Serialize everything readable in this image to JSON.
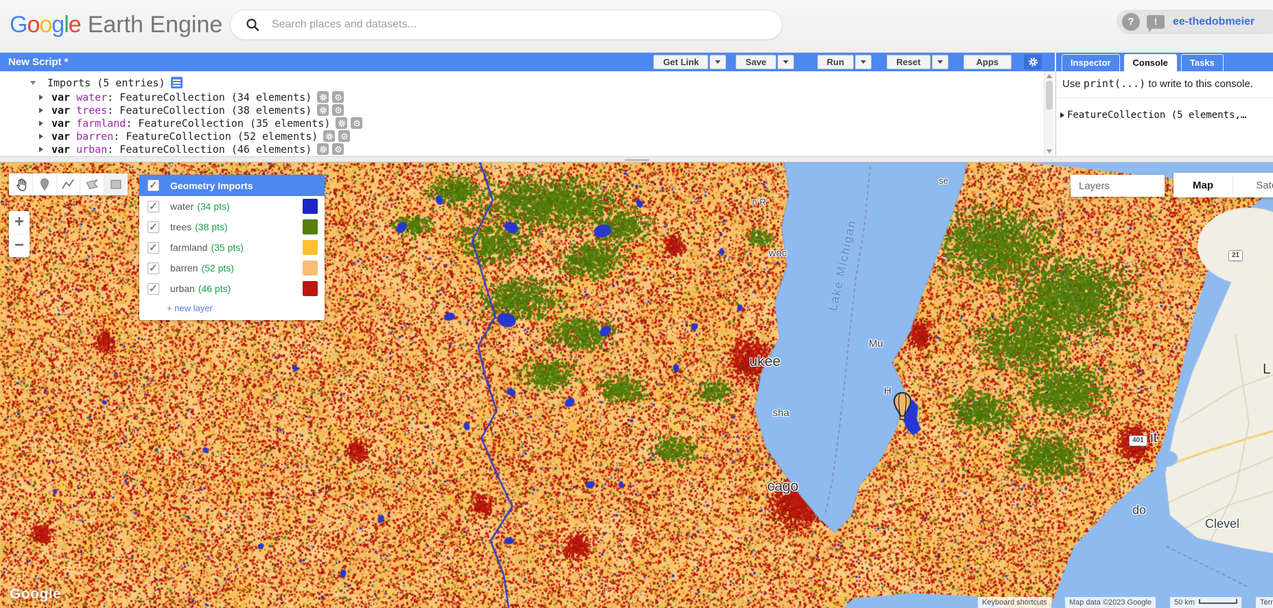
{
  "header": {
    "logo_chars": [
      "G",
      "o",
      "o",
      "g",
      "l",
      "e"
    ],
    "product": "Earth Engine",
    "search_placeholder": "Search places and datasets...",
    "help_glyph": "?",
    "feedback_glyph": "!",
    "user": "ee-thedobmeier"
  },
  "script_bar": {
    "title": "New Script *",
    "get_link": "Get Link",
    "save": "Save",
    "run": "Run",
    "reset": "Reset",
    "apps": "Apps"
  },
  "editor": {
    "imports_label": "Imports (5 entries)",
    "rows": [
      {
        "keyword": "var",
        "name": "water",
        "rest": ": FeatureCollection (34 elements)"
      },
      {
        "keyword": "var",
        "name": "trees",
        "rest": ": FeatureCollection (38 elements)"
      },
      {
        "keyword": "var",
        "name": "farmland",
        "rest": ": FeatureCollection (35 elements)"
      },
      {
        "keyword": "var",
        "name": "barren",
        "rest": ": FeatureCollection (52 elements)"
      },
      {
        "keyword": "var",
        "name": "urban",
        "rest": ": FeatureCollection (46 elements)"
      }
    ]
  },
  "console": {
    "tabs": [
      "Inspector",
      "Console",
      "Tasks"
    ],
    "active_tab": "Console",
    "hint_prefix": "Use ",
    "hint_code": "print(...)",
    "hint_suffix": " to write to this console.",
    "entry": "FeatureCollection (5 elements,…"
  },
  "map": {
    "geometry_panel": {
      "title": "Geometry Imports",
      "layers": [
        {
          "name": "water",
          "count": "(34 pts)",
          "color": "#1a26c9"
        },
        {
          "name": "trees",
          "count": "(38 pts)",
          "color": "#567f0d"
        },
        {
          "name": "farmland",
          "count": "(35 pts)",
          "color": "#fcc12f"
        },
        {
          "name": "barren",
          "count": "(52 pts)",
          "color": "#f9bd78"
        },
        {
          "name": "urban",
          "count": "(46 pts)",
          "color": "#be1511"
        }
      ],
      "new_layer": "+ new layer"
    },
    "controls": {
      "layers": "Layers",
      "map": "Map",
      "satellite": "Satellite",
      "zoom_in": "+",
      "zoom_out": "−"
    },
    "labels": {
      "lake": "Lake Michigan",
      "woc": "woc",
      "ukee": "ukee",
      "sha": "sha",
      "cago": "cago",
      "mu": "Mu",
      "h": "H",
      "se": "se",
      "nr": "n R",
      "it": "it",
      "do_": "do",
      "clevel": "Clevel",
      "l": "L",
      "route401": "401",
      "route21": "21"
    },
    "attribution": {
      "keyboard": "Keyboard shortcuts",
      "map_data": "Map data ©2023 Google",
      "scale": "50 km",
      "terms": "Terms"
    },
    "watermark": "Google"
  }
}
